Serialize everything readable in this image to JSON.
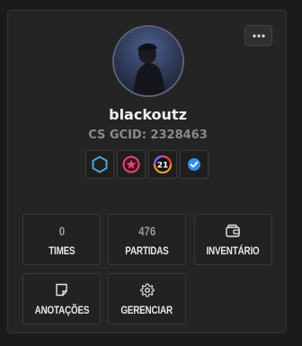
{
  "profile": {
    "username": "blackoutz",
    "gcid": "CS GCID: 2328463"
  },
  "badges": [
    {
      "icon": "hexagon-outline-icon",
      "color": "#4aa8d8"
    },
    {
      "icon": "pink-star-medal-icon",
      "color": "#e8446e"
    },
    {
      "icon": "level-21-ring-icon",
      "text": "21",
      "color": "#f0a020"
    },
    {
      "icon": "verified-check-icon",
      "color": "#2f8fe6"
    }
  ],
  "tiles": {
    "times": {
      "value": "0",
      "label": "TIMES"
    },
    "partidas": {
      "value": "476",
      "label": "PARTIDAS"
    },
    "inventario": {
      "icon": "wallet-icon",
      "label": "INVENTÁRIO"
    },
    "anotacoes": {
      "icon": "note-icon",
      "label": "ANOTAÇÕES"
    },
    "gerenciar": {
      "icon": "gear-icon",
      "label": "GERENCIAR"
    }
  },
  "menu": {
    "icon": "more-horizontal-icon"
  }
}
